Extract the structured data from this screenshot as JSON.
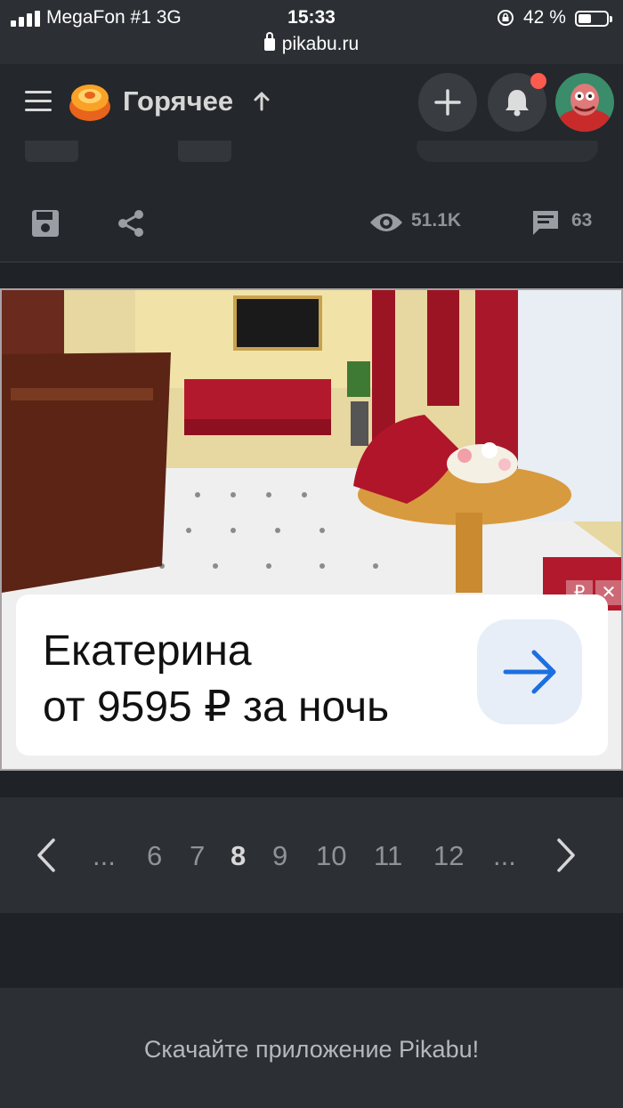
{
  "status_bar": {
    "carrier": "MegaFon #1  3G",
    "time": "15:33",
    "battery": "42 %",
    "battery_level": 0.42
  },
  "browser": {
    "url": "pikabu.ru"
  },
  "header": {
    "title": "Горячее",
    "icons": [
      "menu-icon",
      "pikabu-logo-icon",
      "arrow-up-icon",
      "plus-icon",
      "bell-icon",
      "avatar"
    ]
  },
  "post_actions": {
    "views": "51.1K",
    "comments": "63"
  },
  "ad": {
    "currency_badge": "₽",
    "close_badge": "✕",
    "line1": "Екатерина",
    "line2": "от 9595 ₽ за ночь"
  },
  "pagination": {
    "ellipsis_left": "...",
    "pages": [
      "6",
      "7",
      "8",
      "9",
      "10",
      "11",
      "12"
    ],
    "current": "8",
    "ellipsis_right": "..."
  },
  "footer": {
    "text": "Скачайте приложение Pikabu!"
  },
  "colors": {
    "background": "#1f2226",
    "header": "#24272b",
    "pager": "#2c3035",
    "accent_notification": "#ff5a4f",
    "ad_arrow": "#1c6fe0"
  }
}
